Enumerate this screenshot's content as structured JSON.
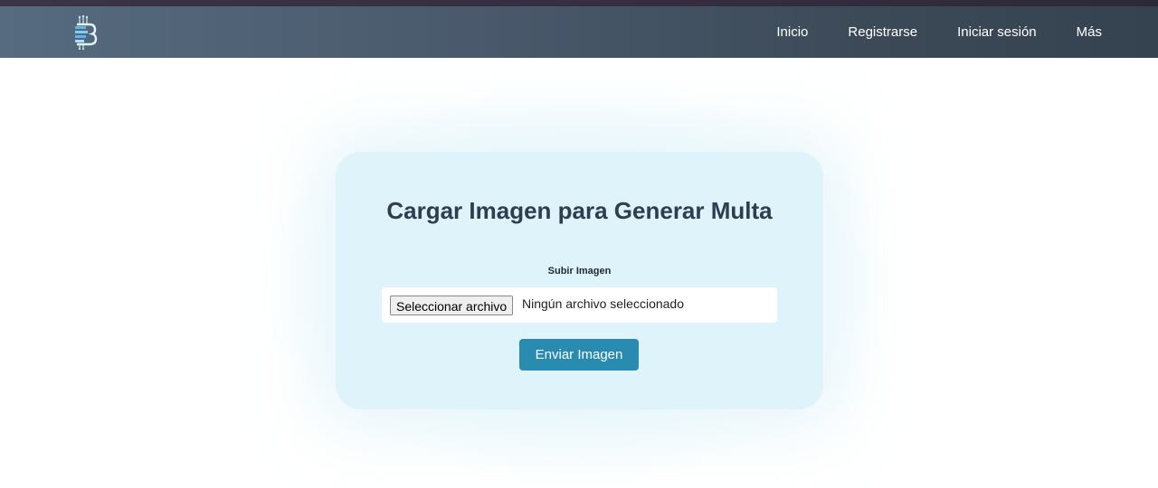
{
  "nav": {
    "logo_icon": "circuit-b-logo-icon",
    "links": [
      "Inicio",
      "Registrarse",
      "Iniciar sesión",
      "Más"
    ]
  },
  "upload_card": {
    "title": "Cargar Imagen para Generar Multa",
    "field_label": "Subir Imagen",
    "file_button_label": "Seleccionar archivo",
    "file_status": "Ningún archivo seleccionado",
    "submit_label": "Enviar Imagen"
  },
  "colors": {
    "navbar": "#4a5a6c",
    "card_background": "#def3fa",
    "title_text": "#2c3e50",
    "submit_button": "#2a8bb0"
  }
}
